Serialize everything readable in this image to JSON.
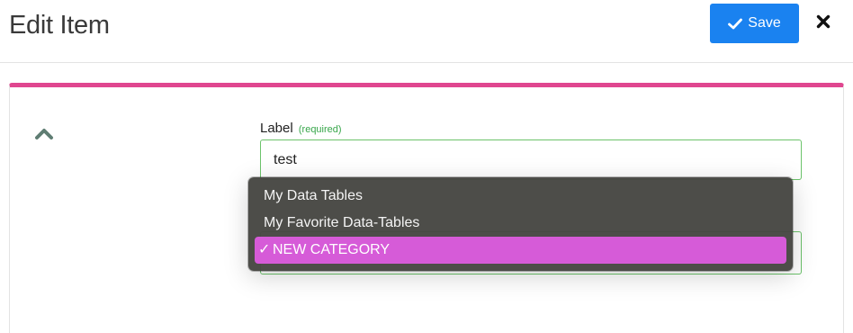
{
  "header": {
    "title": "Edit Item",
    "save_label": "Save"
  },
  "form": {
    "label_field": {
      "label": "Label",
      "required_note": "(required)",
      "value": "test"
    },
    "category_dropdown": {
      "options": [
        {
          "label": "My Data Tables",
          "selected": false
        },
        {
          "label": "My Favorite Data-Tables",
          "selected": false
        },
        {
          "label": "NEW CATEGORY",
          "selected": true
        }
      ],
      "selected_mark": "✓"
    }
  },
  "colors": {
    "save_button": "#1a82f0",
    "card_accent": "#e0468f",
    "input_border": "#6cc36b",
    "required_note": "#37a64a",
    "selected_option": "#d65bd8"
  },
  "icons": {
    "save": "check-icon",
    "close": "close-icon",
    "collapse": "chevron-up-icon"
  }
}
